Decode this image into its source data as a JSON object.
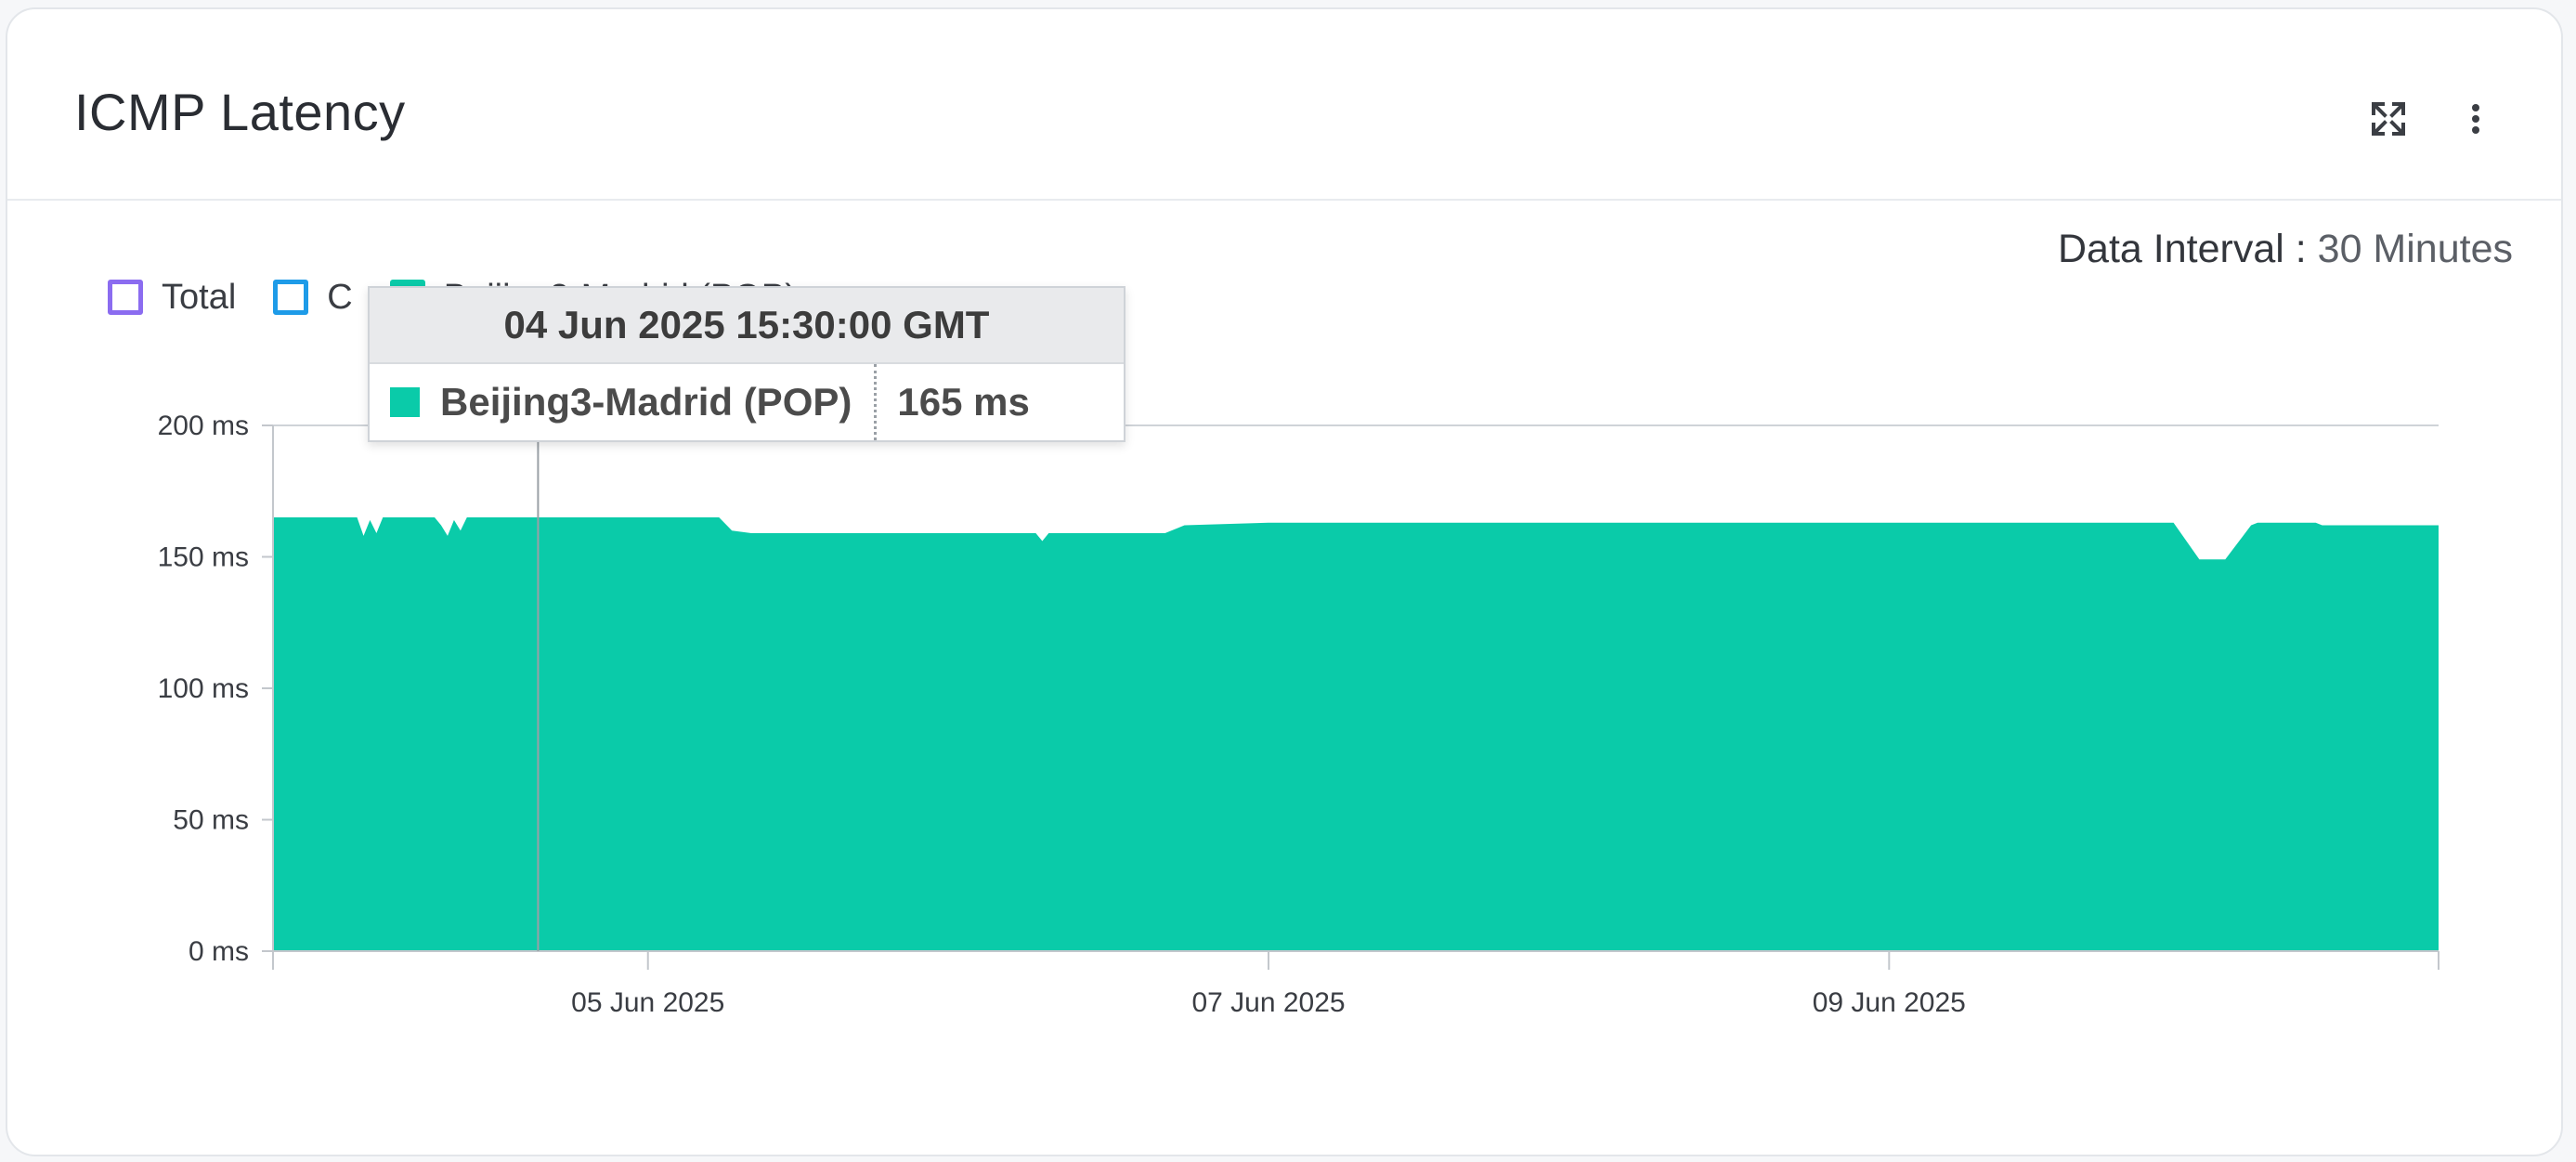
{
  "card": {
    "title": "ICMP Latency",
    "actions": [
      {
        "name": "expand-icon"
      },
      {
        "name": "more-vertical-icon"
      }
    ]
  },
  "data_interval": {
    "label": "Data Interval",
    "separator": ":",
    "value": "30 Minutes"
  },
  "legend": [
    {
      "label": "Total",
      "color": "#8b6cf0",
      "filled": false
    },
    {
      "label": "C",
      "color": "#1e9be8",
      "filled": false
    },
    {
      "label": "Beijing3-Madrid (POP)",
      "color": "#0acba9",
      "filled": true
    }
  ],
  "tooltip": {
    "title": "04 Jun 2025 15:30:00 GMT",
    "series": "Beijing3-Madrid (POP)",
    "value": "165 ms",
    "color": "#0acba9"
  },
  "chart_data": {
    "type": "area",
    "ylabel": "",
    "xlabel": "",
    "ylim": [
      0,
      200
    ],
    "y_ticks": [
      {
        "value": 0,
        "label": "0 ms"
      },
      {
        "value": 50,
        "label": "50 ms"
      },
      {
        "value": 100,
        "label": "100 ms"
      },
      {
        "value": 150,
        "label": "150 ms"
      },
      {
        "value": 200,
        "label": "200 ms"
      }
    ],
    "xlim": [
      "2025-06-03 19:00",
      "2025-06-10 18:30"
    ],
    "x_ticks": [
      {
        "value": "2025-06-05 00:00",
        "label": "05 Jun 2025"
      },
      {
        "value": "2025-06-07 00:00",
        "label": "07 Jun 2025"
      },
      {
        "value": "2025-06-09 00:00",
        "label": "09 Jun 2025"
      }
    ],
    "hover_x": "2025-06-04 15:30",
    "grid": "y-top-only",
    "series": [
      {
        "name": "Beijing3-Madrid (POP)",
        "color": "#0acba9",
        "x": [
          "2025-06-03 19:00",
          "2025-06-04 01:30",
          "2025-06-04 02:00",
          "2025-06-04 02:30",
          "2025-06-04 03:00",
          "2025-06-04 03:30",
          "2025-06-04 07:30",
          "2025-06-04 08:00",
          "2025-06-04 08:30",
          "2025-06-04 09:00",
          "2025-06-04 09:30",
          "2025-06-04 10:00",
          "2025-06-04 10:30",
          "2025-06-04 12:00",
          "2025-06-05 05:30",
          "2025-06-05 06:30",
          "2025-06-05 08:00",
          "2025-06-06 06:00",
          "2025-06-06 06:30",
          "2025-06-06 07:00",
          "2025-06-06 16:00",
          "2025-06-06 17:30",
          "2025-06-07 00:00",
          "2025-06-08 12:00",
          "2025-06-09 12:00",
          "2025-06-09 22:00",
          "2025-06-10 00:00",
          "2025-06-10 02:00",
          "2025-06-10 04:00",
          "2025-06-10 04:30",
          "2025-06-10 09:00",
          "2025-06-10 09:30",
          "2025-06-10 18:30"
        ],
        "y": [
          165,
          165,
          158,
          164,
          159,
          165,
          165,
          162,
          158,
          164,
          160,
          165,
          165,
          165,
          165,
          160,
          159,
          159,
          156,
          159,
          159,
          162,
          163,
          163,
          163,
          163,
          149,
          149,
          162,
          163,
          163,
          162,
          162
        ]
      }
    ]
  }
}
